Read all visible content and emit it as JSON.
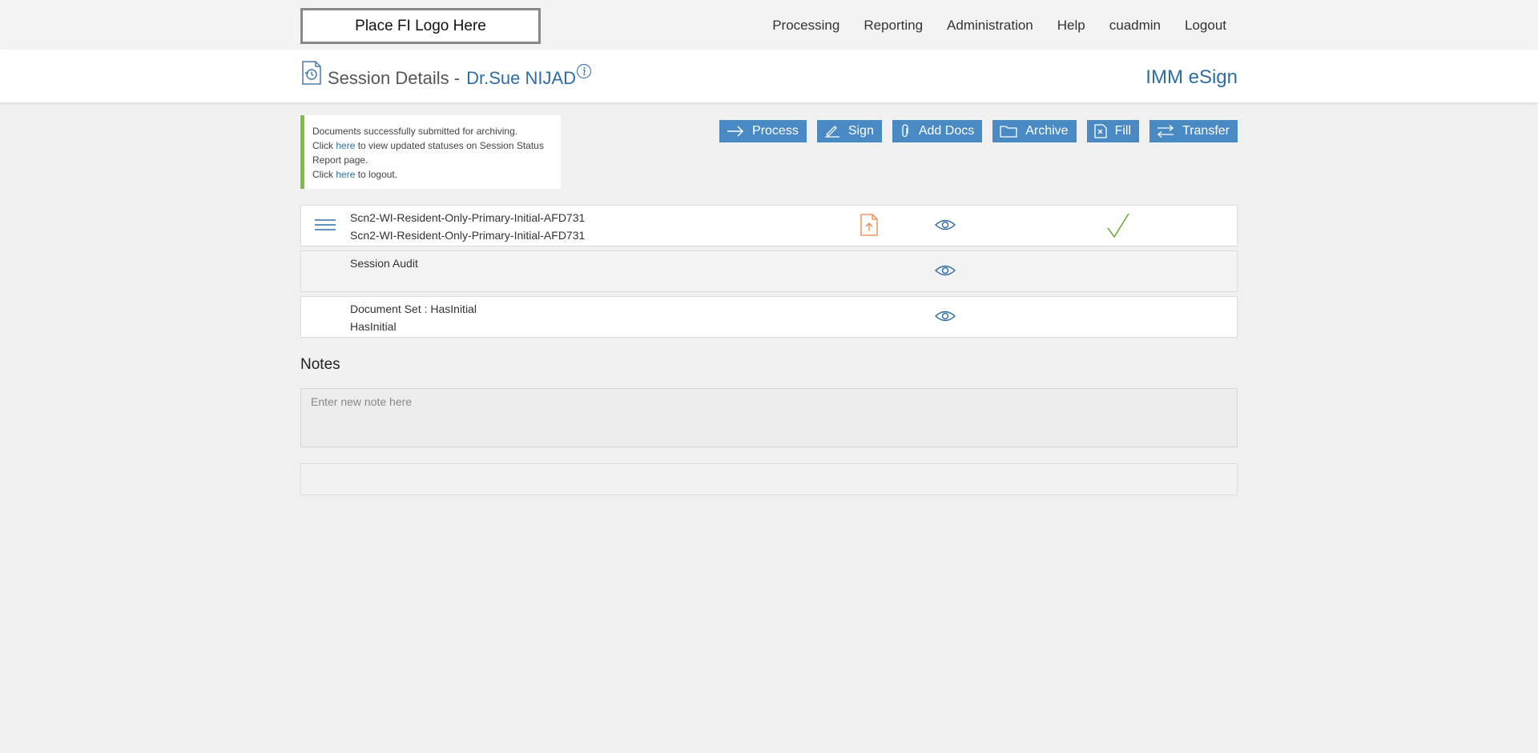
{
  "topbar": {
    "logo_text": "Place FI Logo Here",
    "nav": [
      "Processing",
      "Reporting",
      "Administration",
      "Help",
      "cuadmin",
      "Logout"
    ]
  },
  "header": {
    "title": "Session Details -",
    "signer_name": "Dr.Sue NIJAD",
    "brand": "IMM eSign"
  },
  "alert": {
    "line1": "Documents successfully submitted for archiving.",
    "click1": "Click ",
    "link1": "here",
    "rest1": " to view updated statuses on Session Status Report page.",
    "click2": "Click ",
    "link2": "here",
    "rest2": " to logout.",
    "border_color": "#7cc043"
  },
  "actions": {
    "process": "Process",
    "sign": "Sign",
    "add_docs": "Add Docs",
    "archive": "Archive",
    "fill": "Fill",
    "transfer": "Transfer",
    "button_color": "#4a8ac4"
  },
  "documents": [
    {
      "line1": "Scn2-WI-Resident-Only-Primary-Initial-AFD731",
      "line2": "Scn2-WI-Resident-Only-Primary-Initial-AFD731",
      "icons": [
        "menu-icon",
        "pdf-upload-icon",
        "eye-icon",
        "checkmark-icon"
      ]
    },
    {
      "line1": "Session Audit",
      "line2": "",
      "icons": [
        "eye-icon"
      ]
    },
    {
      "line1": "Document Set : HasInitial",
      "line2": "HasInitial",
      "icons": [
        "eye-icon"
      ]
    }
  ],
  "notes": {
    "heading": "Notes",
    "placeholder": "Enter new note here"
  },
  "colors": {
    "accent": "#2e6da4",
    "pdf_icon": "#f0824a",
    "check": "#6aab3c"
  }
}
